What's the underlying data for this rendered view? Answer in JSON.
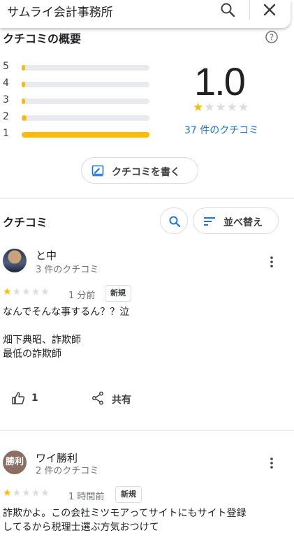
{
  "search": {
    "query": "サムライ会計事務所",
    "search_icon": "search-icon",
    "close_icon": "close-icon"
  },
  "overview": {
    "title": "クチコミの概要",
    "help_icon": "help-icon",
    "distribution": [
      {
        "star": "5",
        "fraction": 0.01
      },
      {
        "star": "4",
        "fraction": 0.01
      },
      {
        "star": "3",
        "fraction": 0.01
      },
      {
        "star": "2",
        "fraction": 0.04
      },
      {
        "star": "1",
        "fraction": 1.0
      }
    ],
    "rating": "1.0",
    "rating_stars": 1,
    "count_text": "37 件のクチコミ",
    "write_label": "クチコミを書く"
  },
  "reviews_header": {
    "title": "クチコミ",
    "sort_label": "並べ替え"
  },
  "reviews": [
    {
      "author": "と中",
      "sub": "3 件のクチコミ",
      "stars": 1,
      "time": "1 分前",
      "badge": "新規",
      "text": "なんでそんな事するん？？泣\n\n畑下典昭、詐欺師\n最低の詐欺師",
      "likes": "1",
      "share_label": "共有"
    },
    {
      "author": "ワイ勝利",
      "avatar_text": "勝利",
      "sub": "2 件のクチコミ",
      "stars": 1,
      "time": "1 時間前",
      "badge": "新規",
      "text": "詐欺かよ。この会社ミツモアってサイトにもサイト登録\nしてるから税理士選ぶ方気おつけて"
    }
  ],
  "colors": {
    "star": "#fbbc04",
    "link": "#1a73e8",
    "bar_track": "#e8eaed"
  }
}
